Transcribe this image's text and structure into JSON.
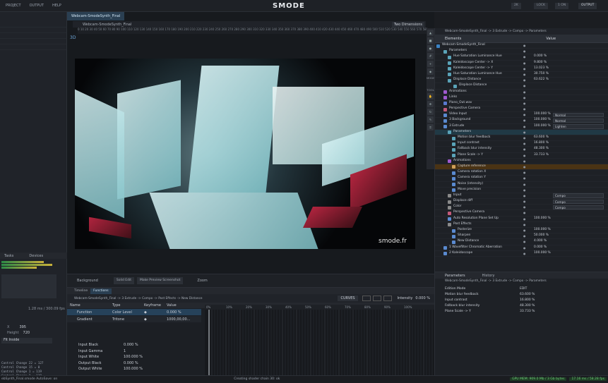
{
  "menu": {
    "items": [
      "PROJECT",
      "OUTPUT",
      "HELP"
    ]
  },
  "app": {
    "logo": "SMODE",
    "buttons": [
      "2K",
      "LOCK",
      "1 ON",
      "OUTPUT"
    ]
  },
  "viewer": {
    "tab": "Webcam-SmodeSynth_Final",
    "path": "Webcam-SmodeSynth_Final",
    "mode": "Two Dimensions",
    "mode_3d": "3D",
    "ruler": "0 10 20 30 40 50 60 70 80 90 100 110 120 130 140 150 160 170 180 190 200 210 220 230 240 250 260 270 280 290 300 310 320 330 340 350 360 370 380 390 400 410 420 430 440 450 460 470 480 490 500 510 520 530 540 550 560 570 580 590 600 610 620 630 640 650 660 670 680 690 700 710 720 730 740 750",
    "watermark": "smode.fr",
    "tool_labels": [
      "MODEL",
      "TOOL"
    ]
  },
  "viewbottom": {
    "background": "Background",
    "buttons": [
      "Solid Edit",
      "Make Preview Screenshot"
    ],
    "zoom": "Zoom"
  },
  "elements": {
    "header_left": "Elements",
    "header_right": "Value",
    "breadcrumb": "Webcam-SmodeSynth_Final -> 3 Extrude -> Compo -> Parameters",
    "rows": [
      {
        "name": "Webcam-SmodeSynth_Final",
        "value": "",
        "color": "#3b83c4",
        "ind": 2
      },
      {
        "name": "Parameters",
        "value": "",
        "color": "#5aa3b8",
        "ind": 12
      },
      {
        "name": "Hue Saturation Luminance Hue",
        "value": "0.000 %",
        "color": "#5aa3b8",
        "ind": 18
      },
      {
        "name": "Kaleidoscope Center -> X",
        "value": "9.800 %",
        "color": "#5aa3b8",
        "ind": 18
      },
      {
        "name": "Kaleidoscope Center -> Y",
        "value": "13.023 %",
        "color": "#5aa3b8",
        "ind": 18
      },
      {
        "name": "Hue Saturation Luminance Hue",
        "value": "30.750 %",
        "color": "#5aa3b8",
        "ind": 18
      },
      {
        "name": "Displace Distance",
        "value": "63.622 %",
        "color": "#5aa3b8",
        "ind": 18
      },
      {
        "name": "Displace Distance",
        "value": "",
        "color": "#5aa3b8",
        "ind": 26
      },
      {
        "name": "Animations",
        "value": "",
        "color": "#a05ad0",
        "ind": 12
      },
      {
        "name": "Links",
        "value": "",
        "color": "#a05ad0",
        "ind": 12
      },
      {
        "name": "Piano_Out.wav",
        "value": "",
        "color": "#5a7ad0",
        "ind": 12
      },
      {
        "name": "Perspective Camera",
        "value": "",
        "color": "#c45a7a",
        "ind": 12
      },
      {
        "name": "Video Input",
        "value": "100.000 %",
        "color": "#5a8ad0",
        "ind": 12,
        "combo": "Normal"
      },
      {
        "name": "3 Background",
        "value": "100.000 %",
        "color": "#5a8ad0",
        "ind": 12,
        "combo": "Normal"
      },
      {
        "name": "3 Extrude",
        "value": "100.000 %",
        "color": "#5a8ad0",
        "ind": 12,
        "combo": "Lighten"
      },
      {
        "name": "Parameters",
        "value": "",
        "color": "#5aa3b8",
        "ind": 18,
        "sel": true
      },
      {
        "name": "Motion blur feedback",
        "value": "63.600 %",
        "color": "#5aa3b8",
        "ind": 24
      },
      {
        "name": "Input contrast",
        "value": "16.800 %",
        "color": "#5aa3b8",
        "ind": 24
      },
      {
        "name": "Fallback blur intensity",
        "value": "48.300 %",
        "color": "#5aa3b8",
        "ind": 24
      },
      {
        "name": "Plane Scale -> Y",
        "value": "33.733 %",
        "color": "#5aa3b8",
        "ind": 24
      },
      {
        "name": "Animations",
        "value": "",
        "color": "#a05ad0",
        "ind": 18
      },
      {
        "name": "Capture reference",
        "value": "",
        "color": "#d0a05a",
        "ind": 24,
        "hl": true
      },
      {
        "name": "Camera rotation X",
        "value": "",
        "color": "#5a8ad0",
        "ind": 24
      },
      {
        "name": "Camera rotation Y",
        "value": "",
        "color": "#5a8ad0",
        "ind": 24
      },
      {
        "name": "Noise (intensity)",
        "value": "",
        "color": "#5a8ad0",
        "ind": 24
      },
      {
        "name": "Move precision",
        "value": "",
        "color": "#5a8ad0",
        "ind": 24
      },
      {
        "name": "Input",
        "value": "",
        "color": "#8a8a8a",
        "ind": 18,
        "combo": "Compo"
      },
      {
        "name": "Displace diff",
        "value": "",
        "color": "#8a8a8a",
        "ind": 18,
        "combo": "Compo"
      },
      {
        "name": "Color",
        "value": "",
        "color": "#8a8a8a",
        "ind": 18,
        "combo": "Compo"
      },
      {
        "name": "Perspective Camera",
        "value": "",
        "color": "#c45a7a",
        "ind": 18
      },
      {
        "name": "Auto Resolution Plane Set Up",
        "value": "100.000 %",
        "color": "#5a8ad0",
        "ind": 18
      },
      {
        "name": "Post Effects",
        "value": "",
        "color": "#8a8a8a",
        "ind": 18
      },
      {
        "name": "Posterize",
        "value": "100.000 %",
        "color": "#5a8ad0",
        "ind": 24
      },
      {
        "name": "Sharpen",
        "value": "50.000 %",
        "color": "#5a8ad0",
        "ind": 24
      },
      {
        "name": "New Distance",
        "value": "4.000 %",
        "color": "#5a8ad0",
        "ind": 24
      },
      {
        "name": "1 Wavefilter Chromatic Aberration",
        "value": "0.000 %",
        "color": "#5a8ad0",
        "ind": 12
      },
      {
        "name": "2 Kaleidoscope",
        "value": "100.000 %",
        "color": "#5a8ad0",
        "ind": 12
      }
    ]
  },
  "params": {
    "tabs": [
      "Parameters",
      "History"
    ],
    "breadcrumb": "Webcam-SmodeSynth_Final -> 3 Extrude -> Compo -> Parameters",
    "rows": [
      {
        "name": "Edition Mode",
        "value": "EDIT"
      },
      {
        "name": "Motion blur feedback",
        "value": "63.600 %"
      },
      {
        "name": "Input contrast",
        "value": "16.800 %"
      },
      {
        "name": "Fallback blur intensity",
        "value": "48.300 %"
      },
      {
        "name": "Plane Scale -> Y",
        "value": "33.733 %"
      }
    ]
  },
  "functions": {
    "tabs": [
      "Timeline",
      "Functions"
    ],
    "breadcrumb": "Webcam-SmodeSynth_Final -> 3 Extrude -> Compo -> Post Effects -> New Distance",
    "buttons": [
      "CURVES"
    ],
    "intensity_label": "Intensity",
    "intensity_value": "0.000 %",
    "columns": [
      "Name",
      "Type",
      "Keyframe",
      "Value"
    ],
    "rows": [
      {
        "name": "Function",
        "type": "Color Level",
        "value": "0.000 %"
      },
      {
        "name": "Gradient",
        "type": "Tritone",
        "value": "1000,00,00..."
      }
    ],
    "props": [
      {
        "name": "Input Black",
        "value": "0.000 %"
      },
      {
        "name": "Input Gamma",
        "value": "1"
      },
      {
        "name": "Input White",
        "value": "100.000 %"
      },
      {
        "name": "Output Black",
        "value": "0.000 %"
      },
      {
        "name": "Output White",
        "value": "100.000 %"
      }
    ],
    "ticks": [
      "0%",
      "10%",
      "20%",
      "30%",
      "40%",
      "50%",
      "60%",
      "70%",
      "80%",
      "90%",
      "100%"
    ]
  },
  "left": {
    "tabs": [
      "Tasks",
      "Devices"
    ],
    "rows": [
      "Control Change 22 = 127",
      "Control Change 15 = 0",
      "Control Change 1 = 119",
      "Control Change 2 = 119",
      "Control Change 8 = 16"
    ],
    "fields": [
      {
        "label": "X",
        "value": "395"
      },
      {
        "label": "Height",
        "value": "720"
      }
    ],
    "status": "1.28 ms / 300.09 fps",
    "footer": "Fit Inside"
  },
  "status": {
    "left": "ebSynth_Final.smode AutoSave: on",
    "center": "Creating shader chain 30: ok",
    "gpu": "GPU MEM: 909.0 Mb / 3 Gb bytes",
    "time": "17.16 ms / 58.28 fps"
  }
}
